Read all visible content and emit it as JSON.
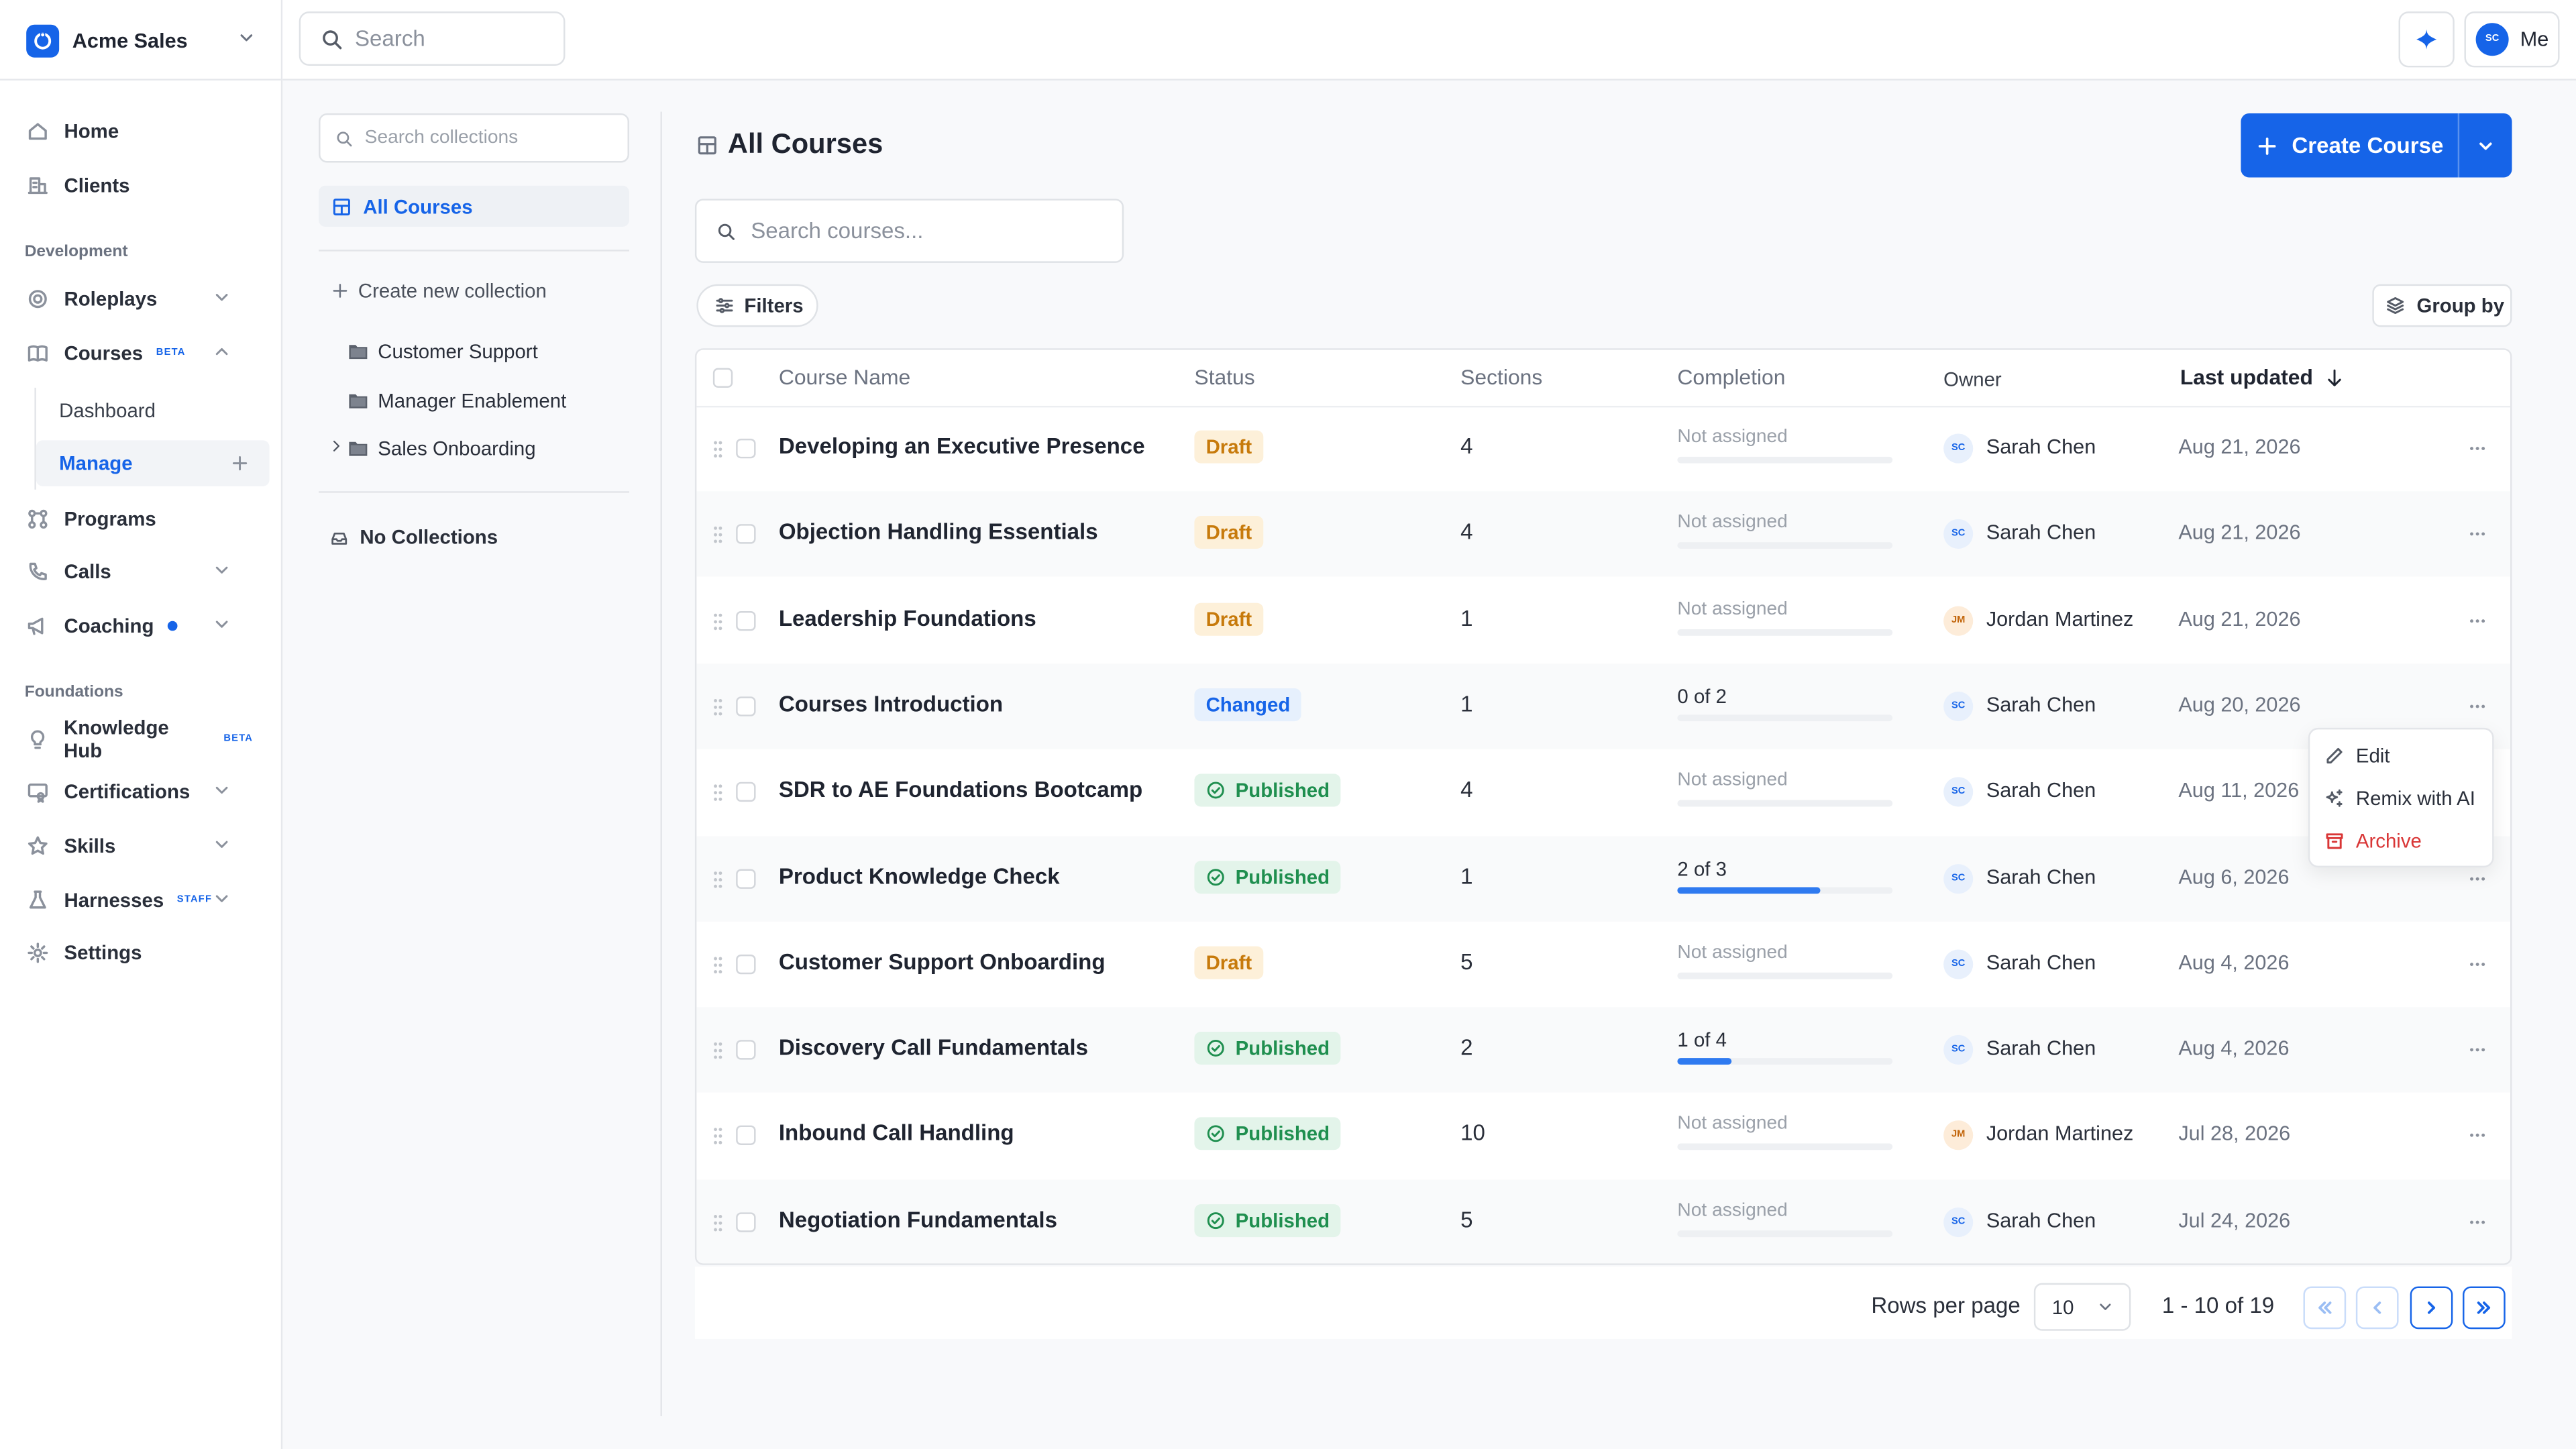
{
  "org": {
    "name": "Acme Sales"
  },
  "topbar": {
    "search_placeholder": "Search",
    "me_initials": "SC",
    "me_label": "Me"
  },
  "sidebar": {
    "home": "Home",
    "clients": "Clients",
    "section_development": "Development",
    "roleplays": "Roleplays",
    "courses": "Courses",
    "courses_badge": "BETA",
    "dashboard": "Dashboard",
    "manage": "Manage",
    "programs": "Programs",
    "calls": "Calls",
    "coaching": "Coaching",
    "section_foundations": "Foundations",
    "knowledge_hub": "Knowledge Hub",
    "knowledge_hub_badge": "BETA",
    "certifications": "Certifications",
    "skills": "Skills",
    "harnesses": "Harnesses",
    "harnesses_badge": "STAFF",
    "settings": "Settings"
  },
  "collections": {
    "search_placeholder": "Search collections",
    "all_courses": "All Courses",
    "create_new": "Create new collection",
    "items": [
      "Customer Support",
      "Manager Enablement",
      "Sales Onboarding"
    ],
    "no_collections": "No Collections"
  },
  "main": {
    "title": "All Courses",
    "create_button": "Create Course",
    "search_placeholder": "Search courses...",
    "filters": "Filters",
    "group_by": "Group by"
  },
  "table": {
    "headers": {
      "name": "Course Name",
      "status": "Status",
      "sections": "Sections",
      "completion": "Completion",
      "owner": "Owner",
      "updated": "Last updated"
    },
    "rows": [
      {
        "name": "Developing an Executive Presence",
        "status": "Draft",
        "sections": "4",
        "completion": "Not assigned",
        "progress": 0,
        "owner_initials": "SC",
        "owner": "Sarah Chen",
        "updated": "Aug 21, 2026"
      },
      {
        "name": "Objection Handling Essentials",
        "status": "Draft",
        "sections": "4",
        "completion": "Not assigned",
        "progress": 0,
        "owner_initials": "SC",
        "owner": "Sarah Chen",
        "updated": "Aug 21, 2026"
      },
      {
        "name": "Leadership Foundations",
        "status": "Draft",
        "sections": "1",
        "completion": "Not assigned",
        "progress": 0,
        "owner_initials": "JM",
        "owner": "Jordan Martinez",
        "updated": "Aug 21, 2026"
      },
      {
        "name": "Courses Introduction",
        "status": "Changed",
        "sections": "1",
        "completion": "0 of 2",
        "progress": 0,
        "owner_initials": "SC",
        "owner": "Sarah Chen",
        "updated": "Aug 20, 2026"
      },
      {
        "name": "SDR to AE Foundations Bootcamp",
        "status": "Published",
        "sections": "4",
        "completion": "Not assigned",
        "progress": 0,
        "owner_initials": "SC",
        "owner": "Sarah Chen",
        "updated": "Aug 11, 2026"
      },
      {
        "name": "Product Knowledge Check",
        "status": "Published",
        "sections": "1",
        "completion": "2 of 3",
        "progress": 0.667,
        "owner_initials": "SC",
        "owner": "Sarah Chen",
        "updated": "Aug 6, 2026"
      },
      {
        "name": "Customer Support Onboarding",
        "status": "Draft",
        "sections": "5",
        "completion": "Not assigned",
        "progress": 0,
        "owner_initials": "SC",
        "owner": "Sarah Chen",
        "updated": "Aug 4, 2026"
      },
      {
        "name": "Discovery Call Fundamentals",
        "status": "Published",
        "sections": "2",
        "completion": "1 of 4",
        "progress": 0.25,
        "owner_initials": "SC",
        "owner": "Sarah Chen",
        "updated": "Aug 4, 2026"
      },
      {
        "name": "Inbound Call Handling",
        "status": "Published",
        "sections": "10",
        "completion": "Not assigned",
        "progress": 0,
        "owner_initials": "JM",
        "owner": "Jordan Martinez",
        "updated": "Jul 28, 2026"
      },
      {
        "name": "Negotiation Fundamentals",
        "status": "Published",
        "sections": "5",
        "completion": "Not assigned",
        "progress": 0,
        "owner_initials": "SC",
        "owner": "Sarah Chen",
        "updated": "Jul 24, 2026"
      }
    ]
  },
  "context_menu": {
    "edit": "Edit",
    "remix": "Remix with AI",
    "archive": "Archive"
  },
  "pagination": {
    "rows_per_page_label": "Rows per page",
    "rows_per_page": "10",
    "range": "1 - 10 of 19"
  },
  "colors": {
    "accent": "#1664e8",
    "draft": "#c77a0b",
    "published": "#1f8f4f",
    "danger": "#d93636"
  }
}
